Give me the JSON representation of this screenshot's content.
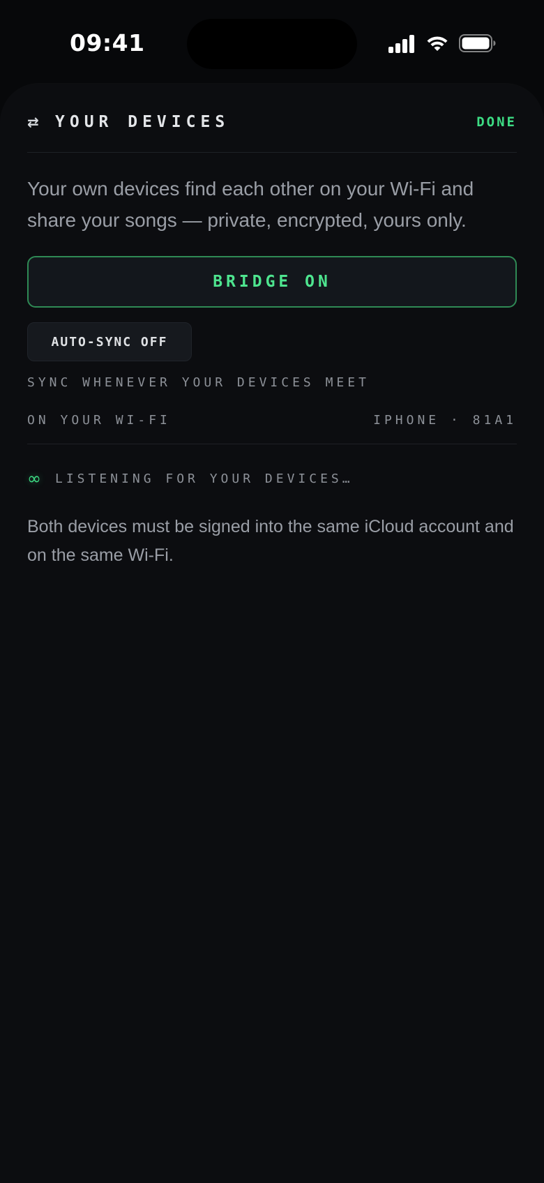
{
  "status_bar": {
    "time": "09:41",
    "icons": [
      "cellular-signal-icon",
      "wifi-icon",
      "battery-icon"
    ]
  },
  "sheet": {
    "header": {
      "icon": "swap-arrows-icon",
      "icon_glyph": "⇄",
      "title": "YOUR DEVICES",
      "done_label": "DONE"
    },
    "intro": "Your own devices find each other on your Wi-Fi and share your songs — private, encrypted, yours only.",
    "bridge_button_label": "BRIDGE ON",
    "autosync_button_label": "AUTO-SYNC OFF",
    "sync_caption": "SYNC WHENEVER YOUR DEVICES MEET",
    "wifi_caption": "ON YOUR WI-FI",
    "device_id": "IPHONE · 81A1",
    "listening": {
      "icon": "infinity-icon",
      "icon_glyph": "∞",
      "text": "LISTENING FOR YOUR DEVICES…"
    },
    "footnote": "Both devices must be signed into the same iCloud account and on the same Wi-Fi."
  },
  "colors": {
    "accent": "#3ddc84",
    "background": "#0c0d10",
    "text_secondary": "#9a9ea6"
  }
}
